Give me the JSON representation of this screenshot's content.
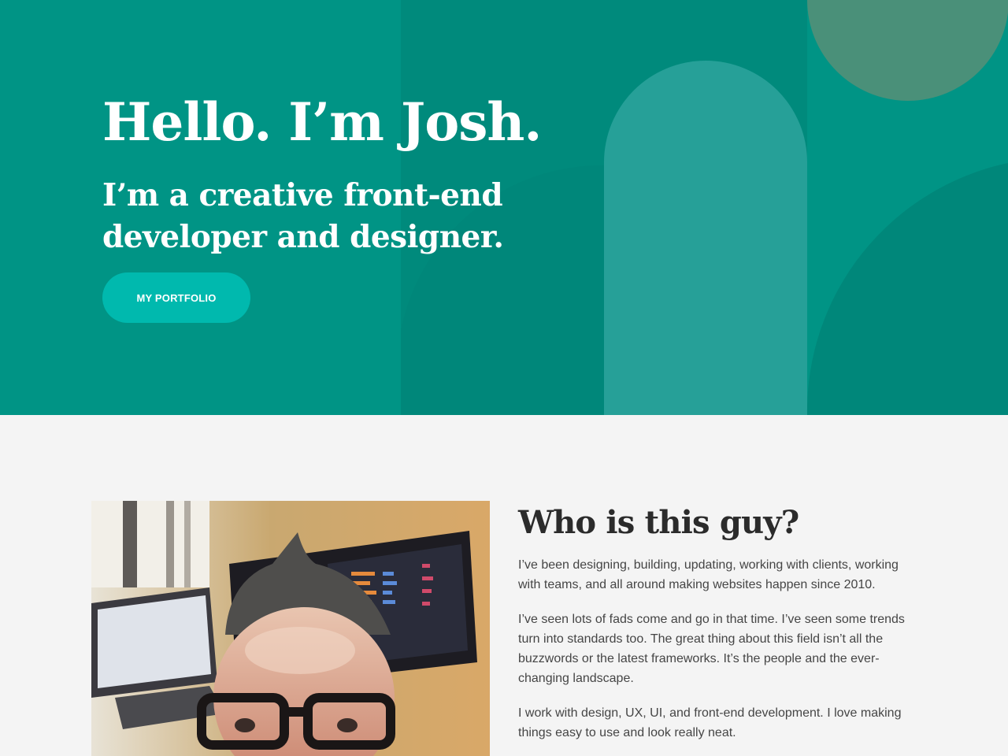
{
  "colors": {
    "hero_background": "#009485",
    "button_background": "#00b9ae",
    "page_background": "#f4f4f4",
    "heading_text": "#2b2b2b",
    "body_text": "#454545"
  },
  "hero": {
    "title": "Hello. I’m Josh.",
    "subtitle": "I’m a creative front-end developer and designer.",
    "button_label": "MY PORTFOLIO"
  },
  "about": {
    "heading": "Who is this guy?",
    "paragraphs": [
      "I’ve been designing, building, updating, working with clients, working with teams, and all around making websites happen since 2010.",
      "I’ve seen lots of fads come and go in that time. I’ve seen some trends turn into standards too. The great thing about this field isn’t all the buzzwords or the latest frameworks. It’s the people and the ever-changing landscape.",
      "I work with design, UX, UI, and front-end development. I love making things easy to use and look really neat."
    ],
    "photo_icon": "portrait-photo"
  }
}
